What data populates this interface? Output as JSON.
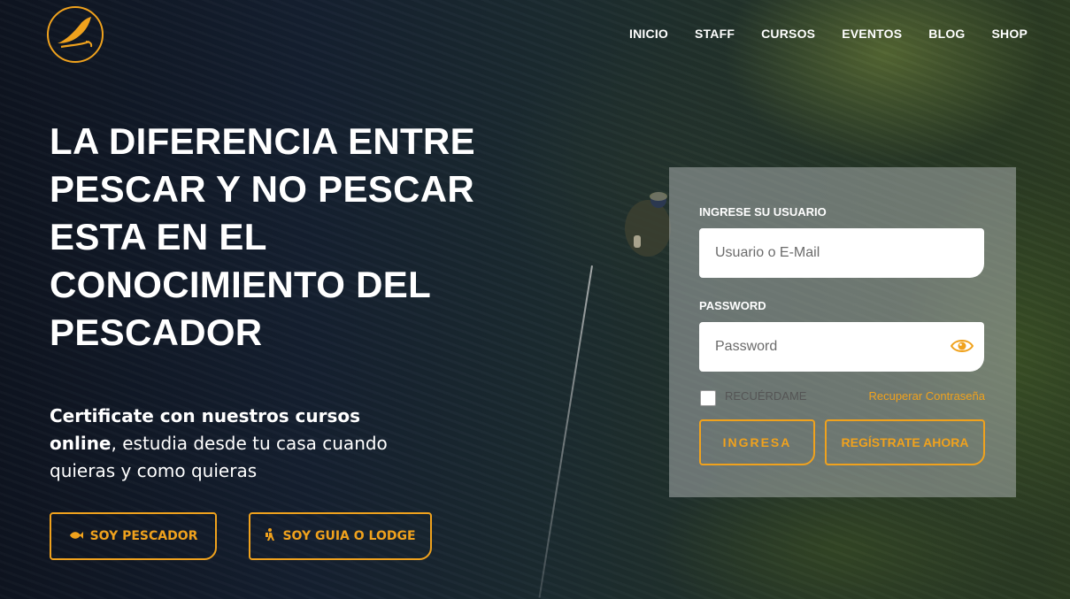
{
  "brand": {
    "logo_icon": "fly-fishing-feather-logo"
  },
  "colors": {
    "accent": "#f0a21d",
    "text": "#ffffff"
  },
  "nav": {
    "items": [
      {
        "label": "INICIO"
      },
      {
        "label": "STAFF"
      },
      {
        "label": "CURSOS"
      },
      {
        "label": "EVENTOS"
      },
      {
        "label": "BLOG"
      },
      {
        "label": "SHOP"
      }
    ]
  },
  "hero": {
    "headline_lines": [
      "LA DIFERENCIA ENTRE",
      "PESCAR Y NO PESCAR",
      "ESTA EN EL",
      "CONOCIMIENTO DEL",
      "PESCADOR"
    ],
    "sub_bold_1": "Certificate con nuestros cursos",
    "sub_bold_2": "online",
    "sub_rest_1": ", estudia desde tu casa cuando",
    "sub_rest_2": "quieras y como quieras",
    "cta_fisher": {
      "label": "SOY PESCADOR",
      "icon": "fish-icon"
    },
    "cta_guide": {
      "label": "SOY GUIA O LODGE",
      "icon": "hiker-icon"
    }
  },
  "login": {
    "user_label": "INGRESE SU USUARIO",
    "user_placeholder": "Usuario o E-Mail",
    "user_value": "",
    "password_label": "PASSWORD",
    "password_placeholder": "Password",
    "password_value": "",
    "remember_label": "RECUÉRDAME",
    "recover_label": "Recuperar Contraseña",
    "submit_label": "INGRESA",
    "register_label": "REGÍSTRATE AHORA"
  }
}
